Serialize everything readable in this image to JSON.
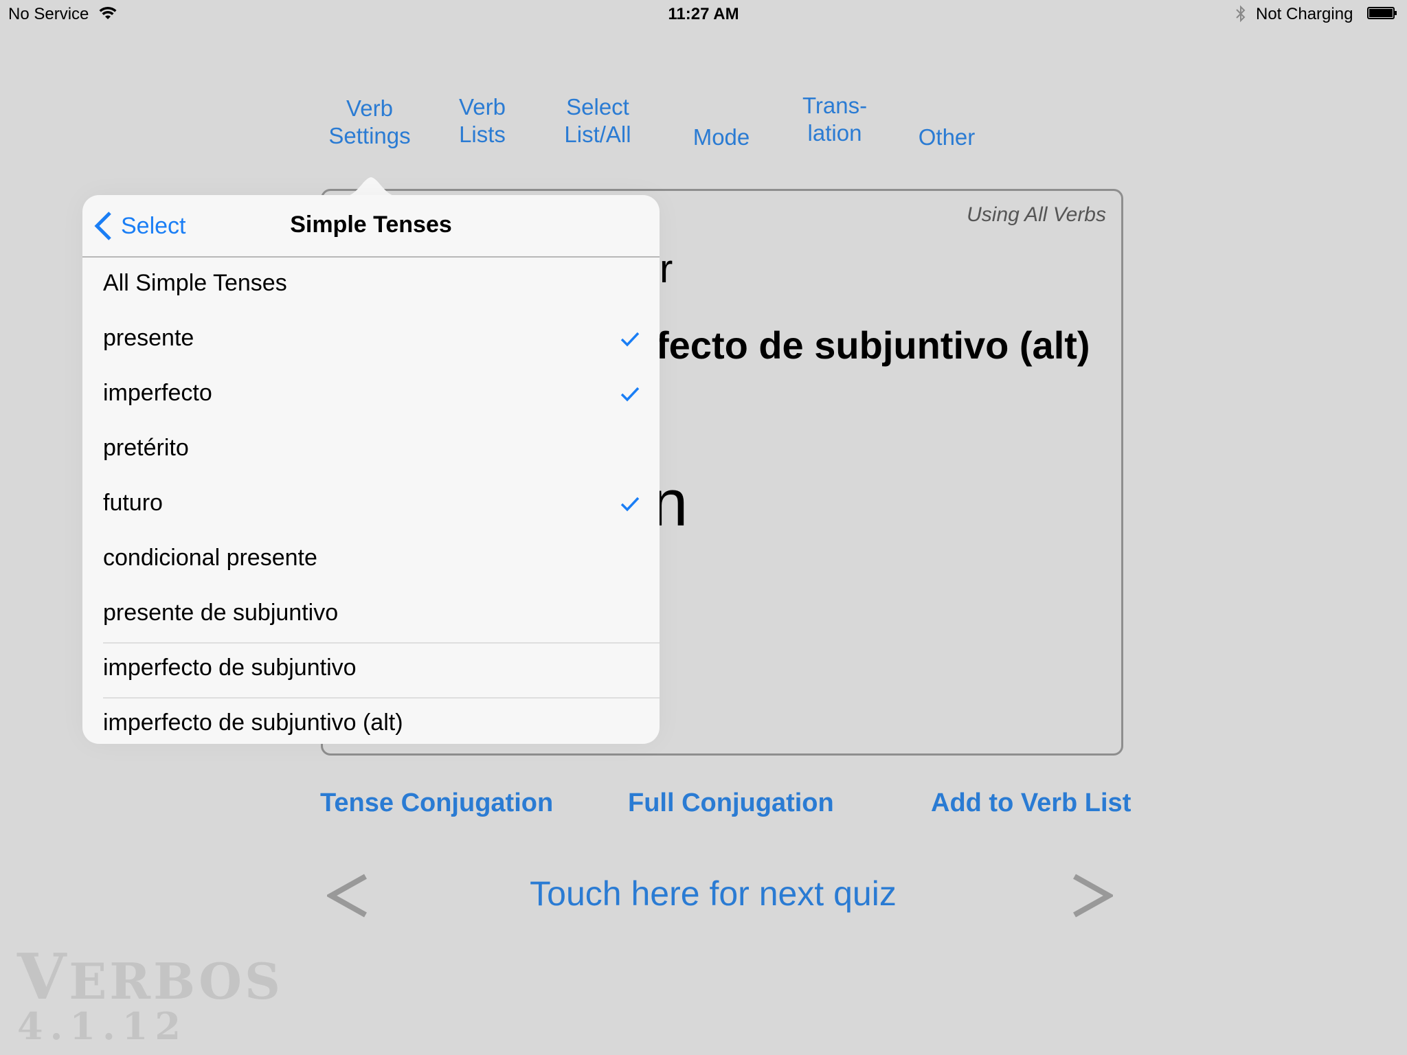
{
  "status_bar": {
    "carrier": "No Service",
    "wifi_icon": "wifi-icon",
    "time": "11:27 AM",
    "bluetooth_icon": "bluetooth-icon",
    "charging": "Not Charging",
    "battery_icon": "battery-icon"
  },
  "tabs": [
    {
      "line1": "Verb",
      "line2": "Settings"
    },
    {
      "line1": "Verb",
      "line2": "Lists"
    },
    {
      "line1": "Select",
      "line2": "List/All"
    },
    {
      "line1": "",
      "line2": "Mode"
    },
    {
      "line1": "Trans-",
      "line2": "lation"
    },
    {
      "line1": "",
      "line2": "Other"
    }
  ],
  "card": {
    "using": "Using All Verbs",
    "verb_partial": "r",
    "tense_partial": "fecto de subjuntivo (alt)",
    "answer_partial": "n"
  },
  "actions": {
    "tense_conjugation": "Tense Conjugation",
    "full_conjugation": "Full Conjugation",
    "add_to_verb_list": "Add to Verb List"
  },
  "quiz": {
    "next": "Touch here for next quiz",
    "prev_arrow": "<",
    "next_arrow": ">"
  },
  "watermark": {
    "name_first": "V",
    "name_rest": "ERBOS",
    "version": "4.1.12"
  },
  "popover": {
    "back_label": "Select",
    "title": "Simple Tenses",
    "items": [
      {
        "label": "All Simple Tenses",
        "checked": false
      },
      {
        "label": "presente",
        "checked": true
      },
      {
        "label": "imperfecto",
        "checked": true
      },
      {
        "label": "pretérito",
        "checked": false
      },
      {
        "label": "futuro",
        "checked": true
      },
      {
        "label": "condicional presente",
        "checked": false
      },
      {
        "label": "presente de subjuntivo",
        "checked": false
      },
      {
        "label": "imperfecto de subjuntivo",
        "checked": false
      },
      {
        "label": "imperfecto de subjuntivo (alt)",
        "checked": false
      }
    ]
  },
  "colors": {
    "accent": "#2a7bd3",
    "popover_accent": "#1a7ef5",
    "background": "#d8d8d8",
    "popover_bg": "#f7f7f7"
  }
}
